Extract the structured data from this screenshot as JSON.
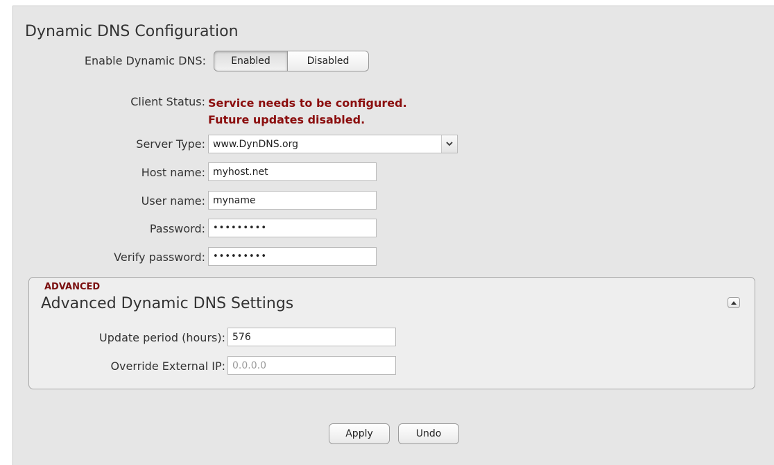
{
  "page": {
    "title": "Dynamic DNS Configuration"
  },
  "enable": {
    "label": "Enable Dynamic DNS:",
    "enabled_label": "Enabled",
    "disabled_label": "Disabled",
    "selected": "Enabled"
  },
  "client_status": {
    "label": "Client Status:",
    "line1": "Service needs to be configured.",
    "line2": "Future updates disabled."
  },
  "server_type": {
    "label": "Server Type:",
    "value": "www.DynDNS.org"
  },
  "host_name": {
    "label": "Host name:",
    "value": "myhost.net"
  },
  "user_name": {
    "label": "User name:",
    "value": "myname"
  },
  "password": {
    "label": "Password:",
    "value": "•••••••••"
  },
  "verify_password": {
    "label": "Verify password:",
    "value": "•••••••••"
  },
  "advanced": {
    "tag": "ADVANCED",
    "title": "Advanced Dynamic DNS Settings",
    "update_period": {
      "label": "Update period (hours):",
      "value": "576"
    },
    "override_ip": {
      "label": "Override External IP:",
      "placeholder": "0.0.0.0"
    }
  },
  "actions": {
    "apply_label": "Apply",
    "undo_label": "Undo"
  },
  "colors": {
    "status_red": "#8b0e0e",
    "advanced_tag": "#7a0f0f",
    "panel_bg": "#e6e6e6"
  },
  "icons": {
    "select_arrow": "chevron-down-icon",
    "collapse": "triangle-up-icon"
  }
}
